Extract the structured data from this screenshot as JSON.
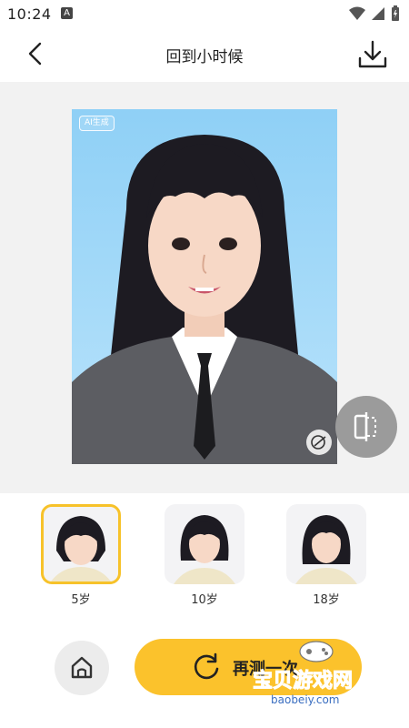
{
  "status": {
    "time": "10:24",
    "notification_icon": "A"
  },
  "header": {
    "title": "回到小时候"
  },
  "preview": {
    "badge": "AI生成"
  },
  "thumbnails": [
    {
      "label": "5岁",
      "selected": true
    },
    {
      "label": "10岁",
      "selected": false
    },
    {
      "label": "18岁",
      "selected": false
    }
  ],
  "actions": {
    "retry_label": "再测一次"
  },
  "watermark": {
    "text": "宝贝游戏网",
    "url": "baobeiy.com"
  },
  "colors": {
    "accent": "#fbc22c",
    "selected_border": "#f7c22a",
    "preview_bg": "#f2f2f2"
  }
}
